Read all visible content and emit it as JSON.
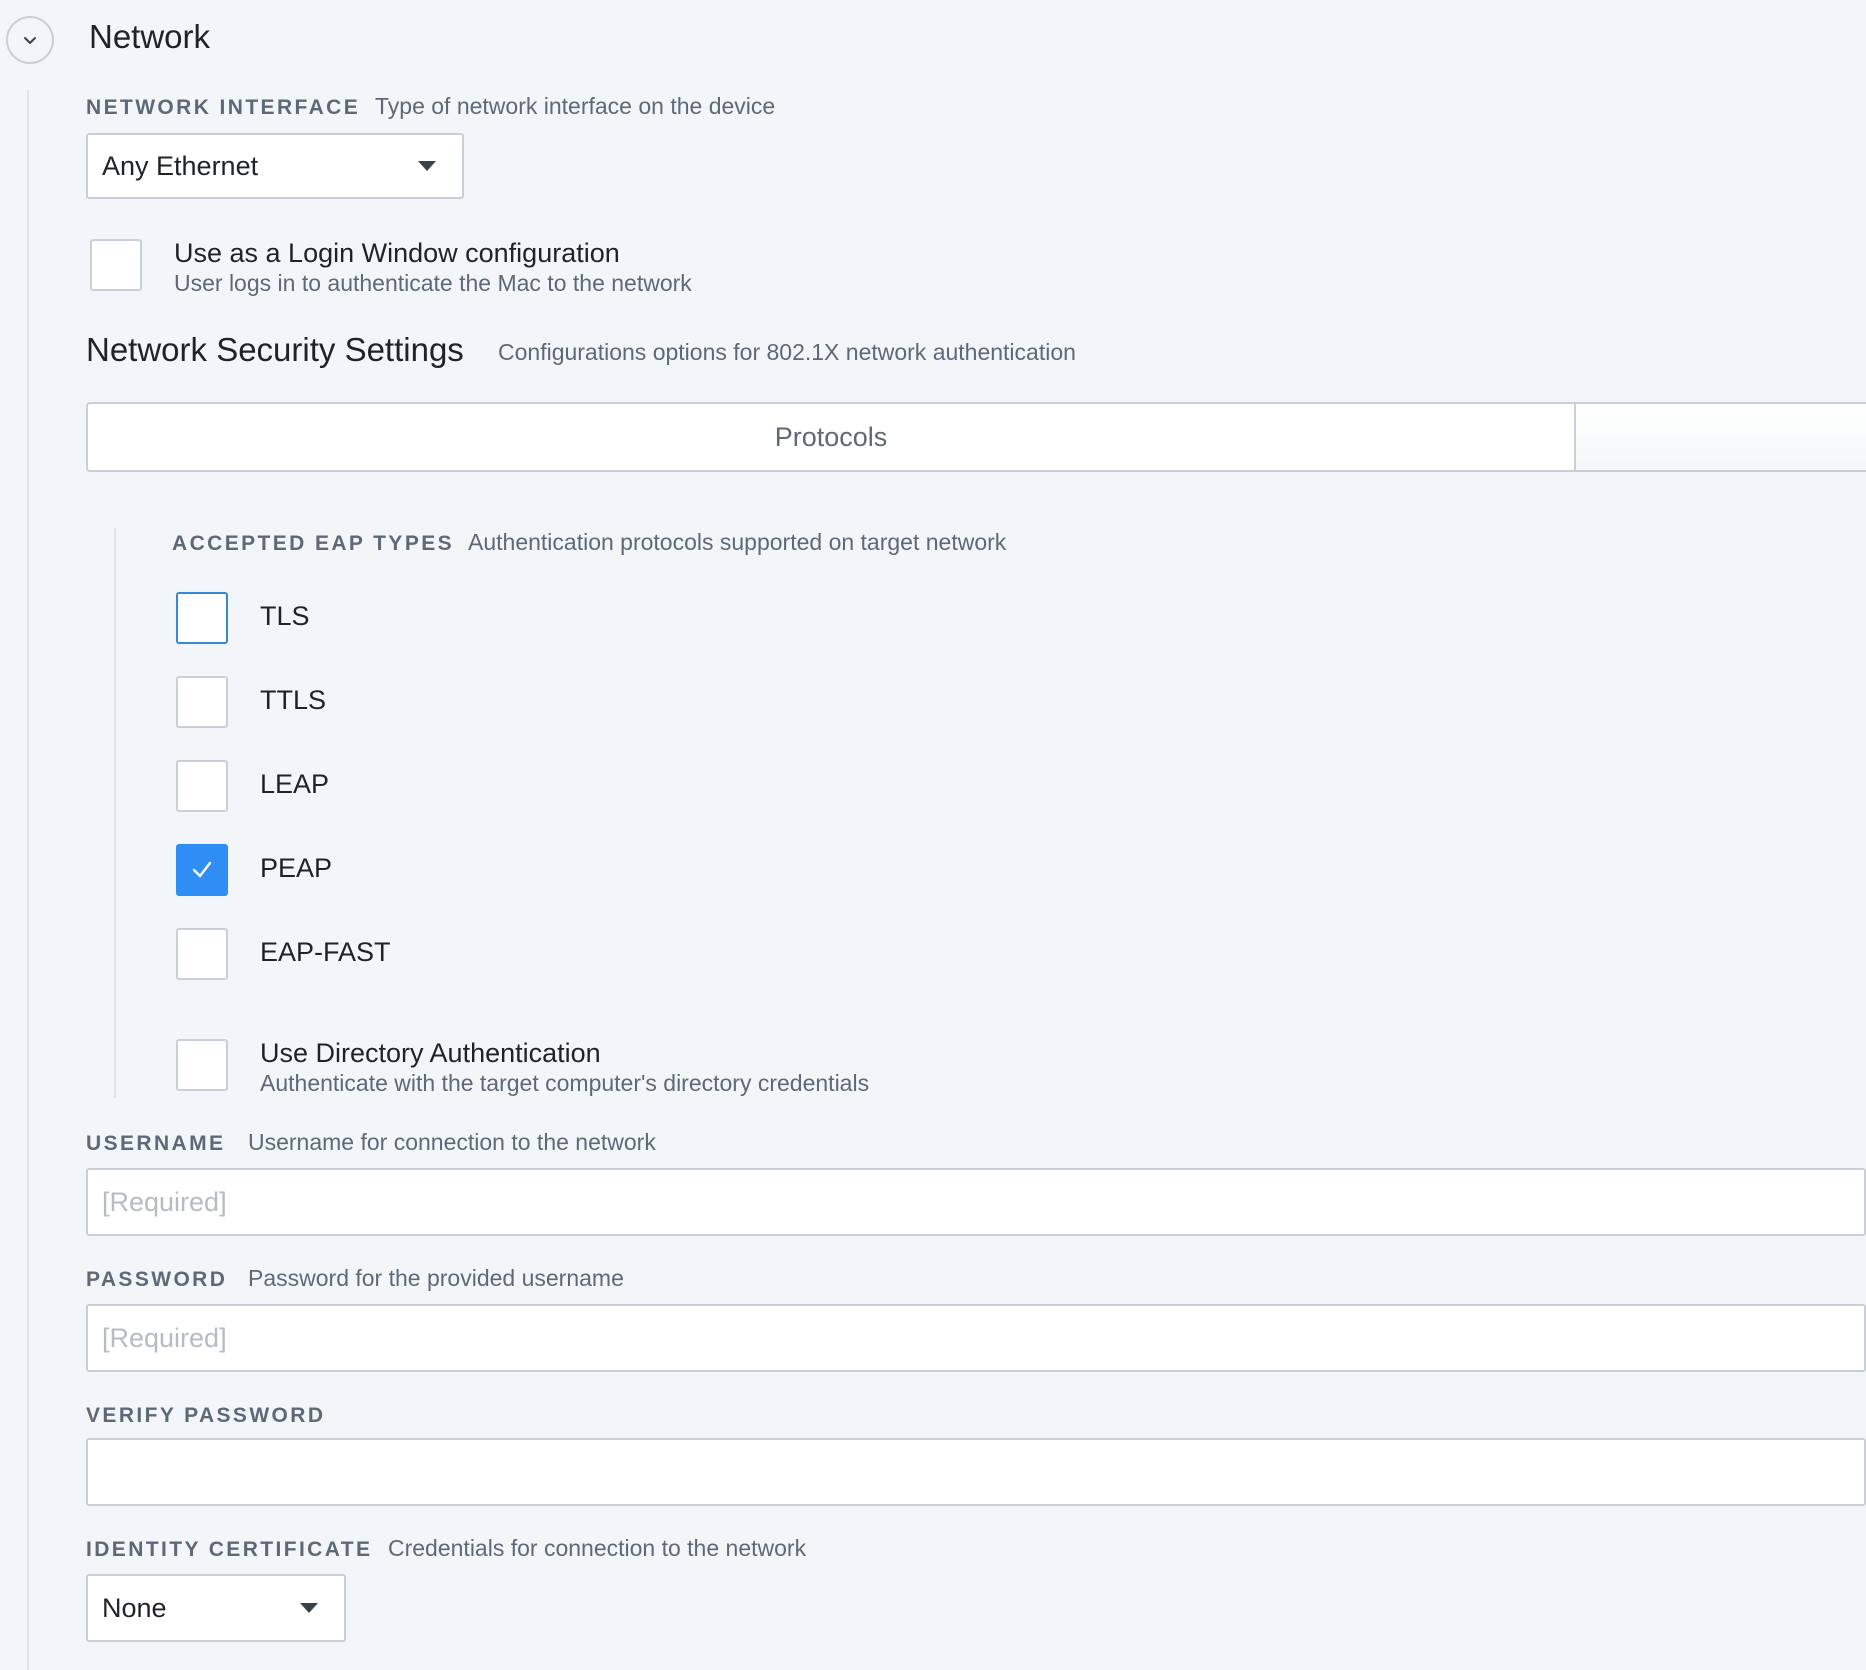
{
  "section": {
    "title": "Network"
  },
  "network_interface": {
    "label": "NETWORK INTERFACE",
    "description": "Type of network interface on the device",
    "selected": "Any Ethernet"
  },
  "login_window": {
    "label": "Use as a Login Window configuration",
    "description": "User logs in to authenticate the Mac to the network",
    "checked": false
  },
  "security": {
    "title": "Network Security Settings",
    "description": "Configurations options for 802.1X network authentication",
    "tabs": [
      {
        "label": "Protocols",
        "active": true
      },
      {
        "label": "",
        "active": false
      }
    ]
  },
  "eap": {
    "label": "ACCEPTED EAP TYPES",
    "description": "Authentication protocols supported on target network",
    "types": [
      {
        "label": "TLS",
        "checked": false
      },
      {
        "label": "TTLS",
        "checked": false
      },
      {
        "label": "LEAP",
        "checked": false
      },
      {
        "label": "PEAP",
        "checked": true
      },
      {
        "label": "EAP-FAST",
        "checked": false
      }
    ]
  },
  "directory_auth": {
    "label": "Use Directory Authentication",
    "description": "Authenticate with the target computer's directory credentials",
    "checked": false
  },
  "username": {
    "label": "USERNAME",
    "description": "Username for connection to the network",
    "placeholder": "[Required]",
    "value": ""
  },
  "password": {
    "label": "PASSWORD",
    "description": "Password for the provided username",
    "placeholder": "[Required]",
    "value": ""
  },
  "verify_password": {
    "label": "VERIFY PASSWORD",
    "value": ""
  },
  "identity_certificate": {
    "label": "IDENTITY CERTIFICATE",
    "description": "Credentials for connection to the network",
    "selected": "None"
  },
  "colors": {
    "accent": "#2f8ef4",
    "background": "#f2f6f9",
    "border": "#c9cfd6",
    "muted_text": "#5e6978"
  },
  "icons": {
    "collapse": "chevron-down-icon",
    "dropdown": "caret-down-icon",
    "check": "checkmark-icon"
  }
}
